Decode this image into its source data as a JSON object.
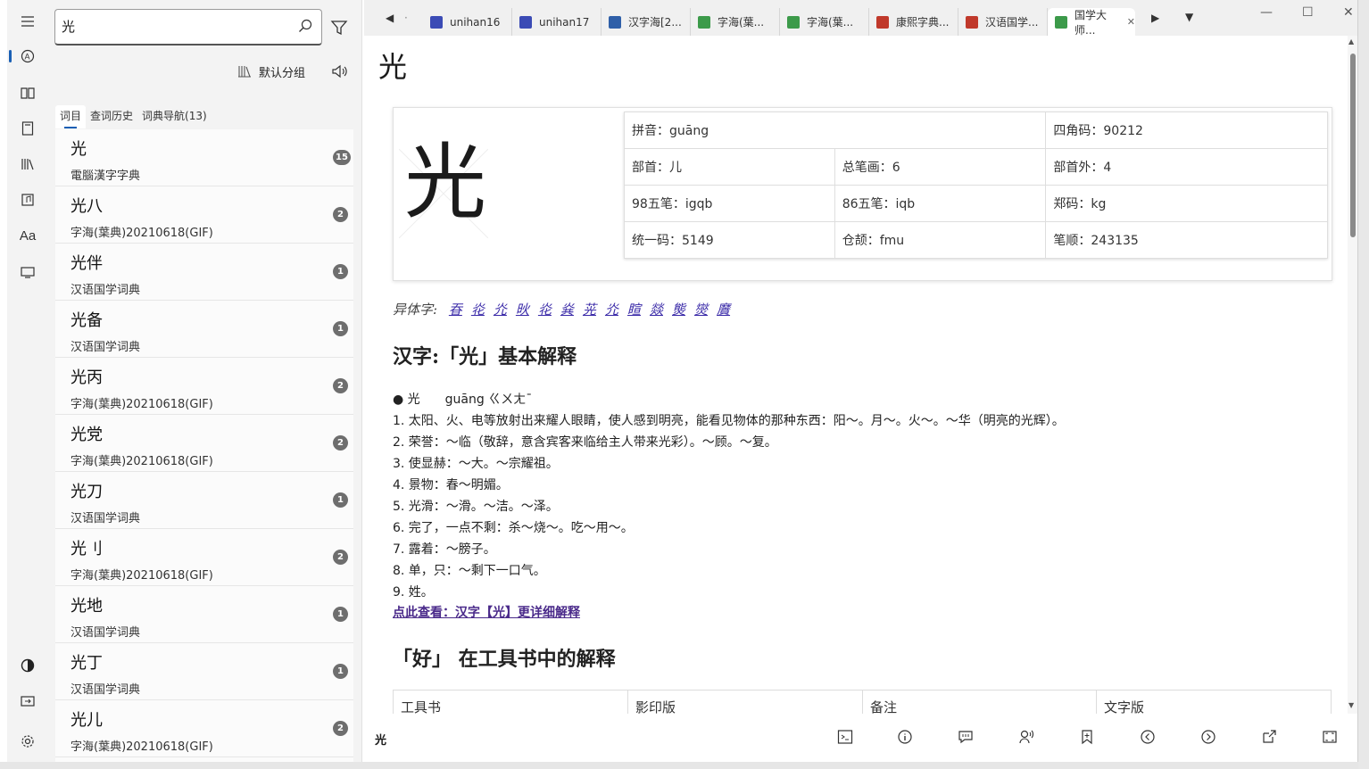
{
  "search": {
    "value": "光"
  },
  "left_panel": {
    "group_label": "默认分组",
    "tabs": [
      "词目",
      "查词历史",
      "词典导航(13)"
    ],
    "items": [
      {
        "word": "光",
        "dict": "電腦漢字字典",
        "count": "15"
      },
      {
        "word": "光八",
        "dict": "字海(葉典)20210618(GIF)",
        "count": "2"
      },
      {
        "word": "光伴",
        "dict": "汉语国学词典",
        "count": "1"
      },
      {
        "word": "光备",
        "dict": "汉语国学词典",
        "count": "1"
      },
      {
        "word": "光丙",
        "dict": "字海(葉典)20210618(GIF)",
        "count": "2"
      },
      {
        "word": "光党",
        "dict": "字海(葉典)20210618(GIF)",
        "count": "2"
      },
      {
        "word": "光刀",
        "dict": "汉语国学词典",
        "count": "1"
      },
      {
        "word": "光刂",
        "dict": "字海(葉典)20210618(GIF)",
        "count": "2"
      },
      {
        "word": "光地",
        "dict": "汉语国学词典",
        "count": "1"
      },
      {
        "word": "光丁",
        "dict": "汉语国学词典",
        "count": "1"
      },
      {
        "word": "光儿",
        "dict": "字海(葉典)20210618(GIF)",
        "count": "2"
      }
    ]
  },
  "tabs": [
    {
      "label": "unihan16",
      "color": "#3b4bb5"
    },
    {
      "label": "unihan17",
      "color": "#3b4bb5"
    },
    {
      "label": "汉字海[2...",
      "color": "#2f5fa8"
    },
    {
      "label": "字海(葉...",
      "color": "#3c9a4a"
    },
    {
      "label": "字海(葉...",
      "color": "#3c9a4a"
    },
    {
      "label": "康熙字典...",
      "color": "#c0392b"
    },
    {
      "label": "汉语国学...",
      "color": "#c0392b"
    },
    {
      "label": "国学大师...",
      "color": "#3c9a4a"
    }
  ],
  "entry": {
    "headword": "光",
    "glyph": "光",
    "info": {
      "pinyin": "拼音：guāng",
      "sijiao": "四角码：90212",
      "bushou": "部首：儿",
      "zongbihua": "总笔画：6",
      "bushouwai": "部首外：4",
      "wubi98": "98五笔：igqb",
      "wubi86": "86五笔：iqb",
      "zhengma": "郑码：kg",
      "unicode": "统一码：5149",
      "cangjie": "仓颉：fmu",
      "bishun": "笔顺：243135"
    },
    "variants_label": "异体字:",
    "variants": [
      "昋",
      "炛",
      "灮",
      "炚",
      "炛",
      "烡",
      "茪",
      "灮",
      "睻",
      "燚",
      "熋",
      "爕",
      "黂"
    ],
    "basic_heading": "汉字:「光」基本解释",
    "pron_line": "● 光　　guāng ㄍㄨㄤˉ",
    "definitions": [
      "1. 太阳、火、电等放射出来耀人眼睛，使人感到明亮，能看见物体的那种东西：阳～。月～。火～。～华（明亮的光辉）。",
      "2. 荣誉：～临（敬辞，意含宾客来临给主人带来光彩）。～顾。～复。",
      "3. 使显赫：～大。～宗耀祖。",
      "4. 景物：春～明媚。",
      "5. 光滑：～滑。～洁。～泽。",
      "6. 完了，一点不剩：杀～烧～。吃～用～。",
      "7. 露着：～膀子。",
      "8. 单，只：～剩下一口气。",
      "9. 姓。"
    ],
    "more_link": "点此查看：汉字【光】更详细解释",
    "tools_heading": "「好」 在工具书中的解释",
    "tools_columns": [
      "工具书",
      "影印版",
      "备注",
      "文字版"
    ]
  },
  "footer": {
    "word": "光"
  }
}
